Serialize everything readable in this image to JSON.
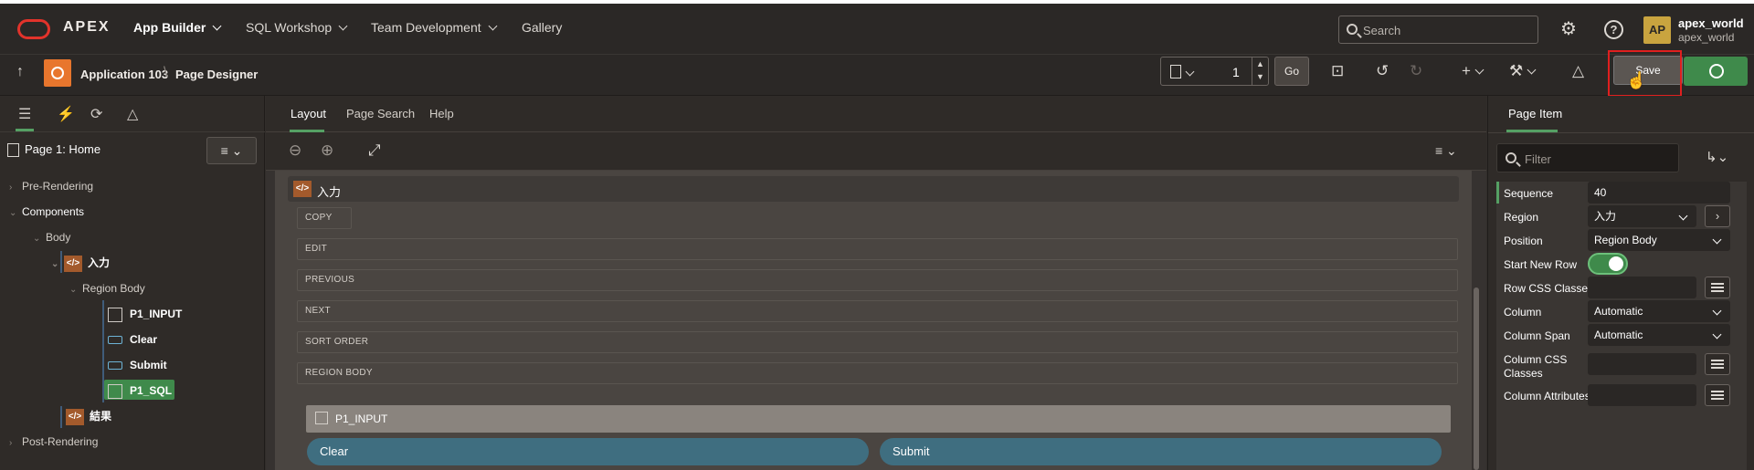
{
  "topnav": {
    "brand": "APEX",
    "menus": [
      "App Builder",
      "SQL Workshop",
      "Team Development",
      "Gallery"
    ],
    "search_placeholder": "Search",
    "avatar_initials": "AP",
    "user_name": "apex_world",
    "user_workspace": "apex_world"
  },
  "toolbar": {
    "app_name": "Application 103",
    "page_designer": "Page Designer",
    "page_number": "1",
    "go_label": "Go",
    "save_label": "Save"
  },
  "left": {
    "page_title": "Page 1: Home",
    "nodes": {
      "pre_rendering": "Pre-Rendering",
      "components": "Components",
      "body": "Body",
      "region_input": "入力",
      "region_body": "Region Body",
      "p1_input": "P1_INPUT",
      "clear": "Clear",
      "submit": "Submit",
      "p1_sql": "P1_SQL",
      "region_result": "結果",
      "post_rendering": "Post-Rendering"
    }
  },
  "center": {
    "tabs": [
      "Layout",
      "Page Search",
      "Help"
    ],
    "region_title": "入力",
    "slots": [
      "COPY",
      "EDIT",
      "PREVIOUS",
      "NEXT",
      "SORT ORDER",
      "REGION BODY"
    ],
    "item_label": "P1_INPUT",
    "buttons": [
      "Clear",
      "Submit"
    ]
  },
  "right": {
    "tab": "Page Item",
    "filter_placeholder": "Filter",
    "properties": {
      "sequence_label": "Sequence",
      "sequence_value": "40",
      "region_label": "Region",
      "region_value": "入力",
      "position_label": "Position",
      "position_value": "Region Body",
      "start_new_row_label": "Start New Row",
      "start_new_row_value": true,
      "row_css_label": "Row CSS Classes",
      "column_label": "Column",
      "column_value": "Automatic",
      "column_span_label": "Column Span",
      "column_span_value": "Automatic",
      "column_css_label_1": "Column CSS",
      "column_css_label_2": "Classes",
      "column_attributes_label": "Column Attributes"
    }
  },
  "colors": {
    "accent_green": "#3f8a4b",
    "save_highlight": "#e01f1f",
    "oracle_red": "#e2332b",
    "app_orange": "#e8762d"
  }
}
